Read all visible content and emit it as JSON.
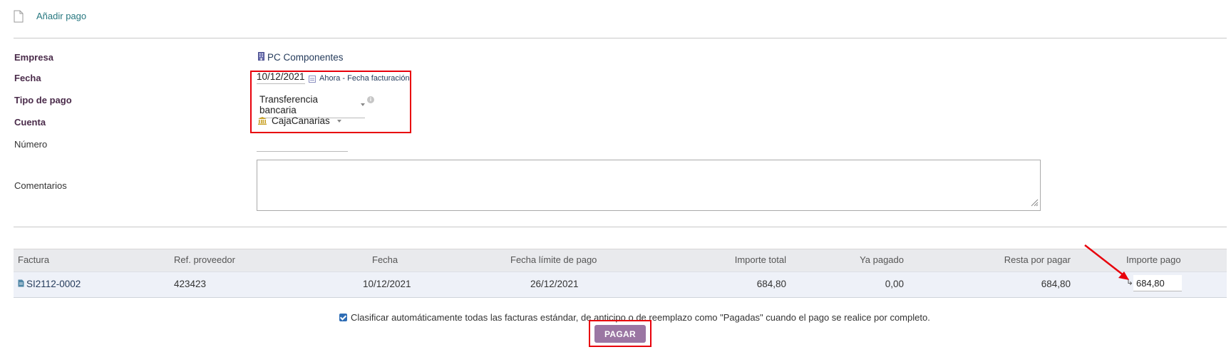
{
  "header": {
    "title": "Añadir pago",
    "icon": "document-icon"
  },
  "form": {
    "empresa": {
      "label": "Empresa",
      "value": "PC Componentes",
      "icon": "building-icon"
    },
    "fecha": {
      "label": "Fecha",
      "value": "10/12/2021",
      "links": "Ahora - Fecha facturación",
      "icon": "calendar-icon"
    },
    "tipo_pago": {
      "label": "Tipo de pago",
      "value": "Transferencia bancaria"
    },
    "cuenta": {
      "label": "Cuenta",
      "value": "CajaCanarias",
      "icon": "bank-icon"
    },
    "numero": {
      "label": "Número",
      "value": ""
    },
    "comentarios": {
      "label": "Comentarios",
      "value": ""
    }
  },
  "table": {
    "columns": [
      "Factura",
      "Ref. proveedor",
      "Fecha",
      "Fecha límite de pago",
      "Importe total",
      "Ya pagado",
      "Resta por pagar",
      "Importe pago"
    ],
    "rows": [
      {
        "factura": "SI2112-0002",
        "ref_proveedor": "423423",
        "fecha": "10/12/2021",
        "fecha_limite": "26/12/2021",
        "importe_total": "684,80",
        "ya_pagado": "0,00",
        "resta_por_pagar": "684,80",
        "importe_pago": "684,80"
      }
    ]
  },
  "auto_classify": {
    "checked": true,
    "label": "Clasificar automáticamente todas las facturas estándar, de anticipo o de reemplazo como \"Pagadas\" cuando el pago se realice por completo."
  },
  "pay_button": {
    "label": "PAGAR"
  },
  "colors": {
    "accent_link": "#26777f",
    "button": "#9b76a3",
    "highlight": "#e8000b",
    "arrow": "#e8000b"
  }
}
